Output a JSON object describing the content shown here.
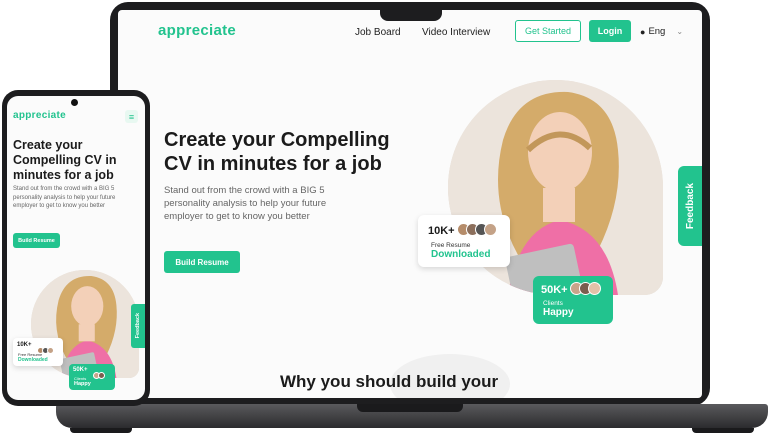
{
  "colors": {
    "brand": "#22c38e",
    "pink": "#ef6fa6",
    "text": "#1b1b1b"
  },
  "laptop": {
    "logo": "appreciate",
    "nav": {
      "job_board": "Job Board",
      "video_interview": "Video Interview"
    },
    "get_started": "Get Started",
    "login": "Login",
    "lang": "Eng",
    "hero_title_1": "Create your Compelling",
    "hero_title_2": "CV in minutes for a job",
    "hero_sub": "Stand out from the crowd with a BIG 5 personality analysis to help your future employer to get to know you better",
    "cta": "Build Resume",
    "stat1": {
      "value": "10K+",
      "label": "Free Resume",
      "sub": "Downloaded"
    },
    "stat2": {
      "value": "50K+",
      "label": "Clients",
      "sub": "Happy"
    },
    "feedback": "Feedback",
    "section_heading": "Why you should build your"
  },
  "phone": {
    "logo": "appreciate",
    "hero_title": "Create your Compelling CV in minutes for a job",
    "hero_sub": "Stand out from the crowd with a BIG 5 personality analysis to help your future employer to get to know you better",
    "cta": "Build Resume",
    "stat1": {
      "value": "10K+",
      "label": "Free Resume",
      "sub": "Downloaded"
    },
    "stat2": {
      "value": "50K+",
      "label": "Clients",
      "sub": "Happy"
    },
    "feedback": "Feedback"
  }
}
